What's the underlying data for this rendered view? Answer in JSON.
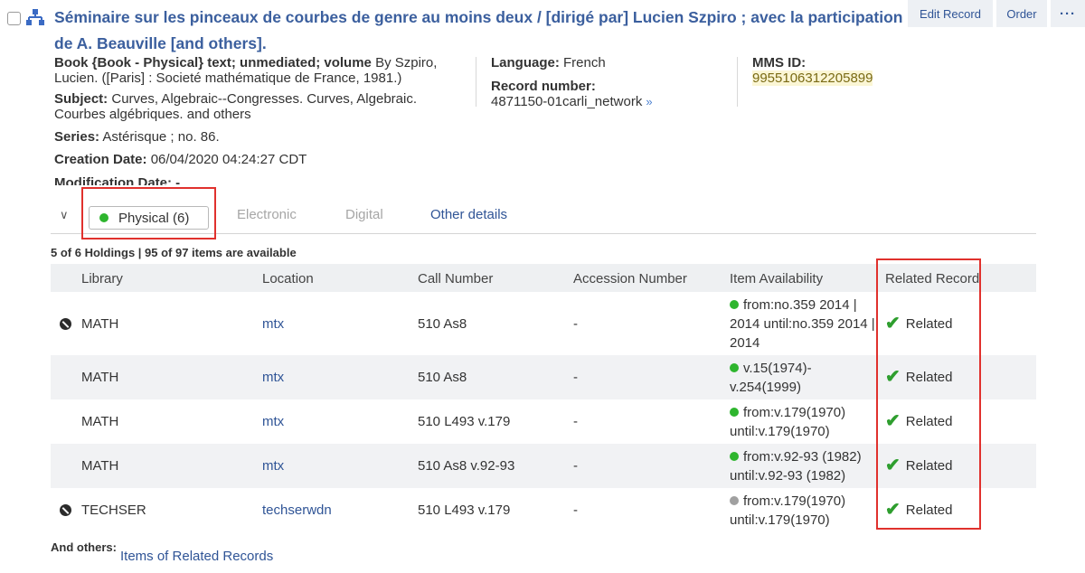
{
  "record": {
    "title": "Séminaire sur les pinceaux de courbes de genre au moins deux / [dirigé par] Lucien Szpiro ; avec la participation de A. Beauville [and others].",
    "format_label": "Book {Book - Physical} text; unmediated; volume",
    "format_by": " By Szpiro, Lucien. ([Paris] : Societé mathématique de France, 1981.)",
    "subject_label": "Subject:",
    "subject_value": " Curves, Algebraic--Congresses. Curves, Algebraic. Courbes algébriques. and others",
    "series_label": "Series:",
    "series_value": " Astérisque ; no. 86.",
    "creation_label": "Creation Date:",
    "creation_value": " 06/04/2020 04:24:27 CDT",
    "modification_label": "Modification Date: -",
    "language_label": "Language:",
    "language_value": " French",
    "record_number_label": "Record number:",
    "record_number_value": "4871150-01carli_network",
    "mms_label": "MMS ID:",
    "mms_value": "9955106312205899"
  },
  "toolbar": {
    "edit_label": "Edit Record",
    "order_label": "Order",
    "more_label": "···"
  },
  "tabs": {
    "physical": "Physical (6)",
    "electronic": "Electronic",
    "digital": "Digital",
    "other": "Other details"
  },
  "holdings": {
    "summary": "5 of 6 Holdings | 95 of 97 items are available",
    "columns": {
      "library": "Library",
      "location": "Location",
      "call_number": "Call Number",
      "accession": "Accession Number",
      "availability": "Item Availability",
      "related": "Related Record"
    },
    "rows": [
      {
        "library": "MATH",
        "location": "mtx",
        "call_number": "510 As8",
        "accession": "-",
        "availability": "from:no.359 2014 | 2014 until:no.359 2014 | 2014",
        "related": "Related"
      },
      {
        "library": "MATH",
        "location": "mtx",
        "call_number": "510 As8",
        "accession": "-",
        "availability": "v.15(1974)- v.254(1999)",
        "related": "Related"
      },
      {
        "library": "MATH",
        "location": "mtx",
        "call_number": "510 L493 v.179",
        "accession": "-",
        "availability": "from:v.179(1970) until:v.179(1970)",
        "related": "Related"
      },
      {
        "library": "MATH",
        "location": "mtx",
        "call_number": "510 As8 v.92-93",
        "accession": "-",
        "availability": "from:v.92-93 (1982) until:v.92-93 (1982)",
        "related": "Related"
      },
      {
        "library": "TECHSER",
        "location": "techserwdn",
        "call_number": "510 L493 v.179",
        "accession": "-",
        "availability": "from:v.179(1970) until:v.179(1970)",
        "related": "Related"
      }
    ]
  },
  "footer": {
    "others_label": "And others:",
    "others_link": "Items of Related Records"
  },
  "colors": {
    "link": "#2f5496",
    "available_dot": "#2eb52e",
    "unavailable_dot": "#a0a0a0",
    "highlight_box": "#e0312d",
    "check": "#2e9e2e"
  }
}
